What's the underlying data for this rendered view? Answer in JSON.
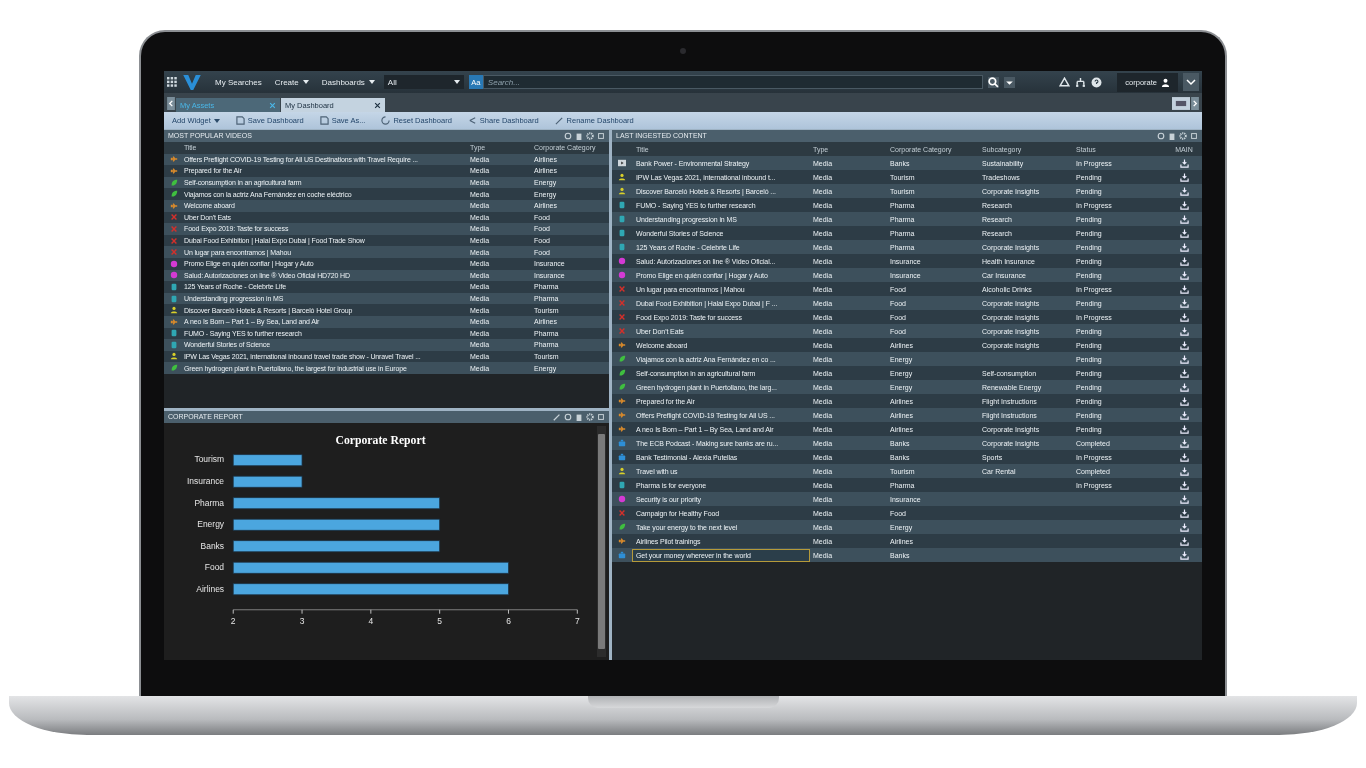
{
  "top_bar": {
    "menus": [
      {
        "label": "My Searches",
        "dropdown": false
      },
      {
        "label": "Create",
        "dropdown": true
      },
      {
        "label": "Dashboards",
        "dropdown": true
      }
    ],
    "scope": "All",
    "case_button": "Aa",
    "search": {
      "placeholder": "Search..."
    },
    "user": "corporate"
  },
  "tabs": [
    {
      "label": "My Assets",
      "selected": false
    },
    {
      "label": "My Dashboard",
      "selected": true
    }
  ],
  "toolbar": [
    {
      "label": "Add Widget",
      "kind": "menu"
    },
    {
      "label": "Save Dashboard",
      "kind": "save"
    },
    {
      "label": "Save As...",
      "kind": "save"
    },
    {
      "label": "Reset Dashboard",
      "kind": "reset"
    },
    {
      "label": "Share Dashboard",
      "kind": "share"
    },
    {
      "label": "Rename Dashboard",
      "kind": "rename"
    }
  ],
  "popular": {
    "title": "MOST POPULAR VIDEOS",
    "columns": [
      "Title",
      "Type",
      "Corporate Category"
    ],
    "rows": [
      {
        "kind": "plane",
        "title": "Offers Preflight COVID-19 Testing for All US Destinations with Travel Require ...",
        "type": "Media",
        "category": "Airlines"
      },
      {
        "kind": "plane",
        "title": "Prepared for the Air",
        "type": "Media",
        "category": "Airlines"
      },
      {
        "kind": "leaf",
        "title": "Self-consumption in an agricultural farm",
        "type": "Media",
        "category": "Energy"
      },
      {
        "kind": "leaf",
        "title": "Viajamos con la actriz Ana Fernández en coche eléctrico",
        "type": "Media",
        "category": "Energy"
      },
      {
        "kind": "plane",
        "title": "Welcome aboard",
        "type": "Media",
        "category": "Airlines"
      },
      {
        "kind": "cross",
        "title": "Uber Don't Eats",
        "type": "Media",
        "category": "Food"
      },
      {
        "kind": "cross",
        "title": "Food Expo 2019: Taste for success",
        "type": "Media",
        "category": "Food"
      },
      {
        "kind": "cross",
        "title": "Dubai Food Exhibition | Halal Expo Dubai | Food Trade Show",
        "type": "Media",
        "category": "Food"
      },
      {
        "kind": "cross",
        "title": "Un lugar para encontramos | Mahou",
        "type": "Media",
        "category": "Food"
      },
      {
        "kind": "badge",
        "title": "Promo Elige en quién confiar | Hogar y Auto",
        "type": "Media",
        "category": "Insurance"
      },
      {
        "kind": "badge",
        "title": "Salud: Autorizaciones on line ® Video Oficial HD720 HD",
        "type": "Media",
        "category": "Insurance"
      },
      {
        "kind": "bottle",
        "title": "125 Years of Roche - Celebrte Life",
        "type": "Media",
        "category": "Pharma"
      },
      {
        "kind": "bottle",
        "title": "Understanding progression in MS",
        "type": "Media",
        "category": "Pharma"
      },
      {
        "kind": "person",
        "title": "Discover Barceló Hotels & Resorts | Barceló Hotel Group",
        "type": "Media",
        "category": "Tourism"
      },
      {
        "kind": "plane",
        "title": "A neo Is Born – Part 1 – By Sea, Land and Air",
        "type": "Media",
        "category": "Airlines"
      },
      {
        "kind": "bottle",
        "title": "FUMO - Saying YES to further research",
        "type": "Media",
        "category": "Pharma"
      },
      {
        "kind": "bottle",
        "title": "Wonderful Stories of Science",
        "type": "Media",
        "category": "Pharma"
      },
      {
        "kind": "person",
        "title": "IPW Las Vegas 2021, international inbound travel trade show - Unravel Travel ...",
        "type": "Media",
        "category": "Tourism"
      },
      {
        "kind": "leaf",
        "title": "Green hydrogen plant in Puertollano, the largest for industrial use in Europe",
        "type": "Media",
        "category": "Energy"
      }
    ]
  },
  "report": {
    "title": "CORPORATE REPORT",
    "chart_data": {
      "type": "bar",
      "orientation": "horizontal",
      "title": "Corporate Report",
      "categories": [
        "Tourism",
        "Insurance",
        "Pharma",
        "Energy",
        "Banks",
        "Food",
        "Airlines"
      ],
      "values": [
        3,
        3,
        5,
        5,
        5,
        6,
        6
      ],
      "xlim": [
        2,
        7
      ],
      "xticks": [
        2,
        3,
        4,
        5,
        6,
        7
      ]
    }
  },
  "latest": {
    "title": "LAST INGESTED CONTENT",
    "columns": [
      "Title",
      "Type",
      "Corporate Category",
      "Subcategory",
      "Status",
      "MAIN"
    ],
    "rows": [
      {
        "kind": "film",
        "title": "Bank Power - Environmental Strategy",
        "type": "Media",
        "category": "Banks",
        "subcategory": "Sustainability",
        "status": "In Progress",
        "selected": false
      },
      {
        "kind": "person",
        "title": "IPW Las Vegas 2021, international inbound t...",
        "type": "Media",
        "category": "Tourism",
        "subcategory": "Tradeshows",
        "status": "Pending",
        "selected": false
      },
      {
        "kind": "person",
        "title": "Discover Barceló Hotels & Resorts | Barceló ...",
        "type": "Media",
        "category": "Tourism",
        "subcategory": "Corporate Insights",
        "status": "Pending",
        "selected": false
      },
      {
        "kind": "bottle",
        "title": "FUMO - Saying YES to further research",
        "type": "Media",
        "category": "Pharma",
        "subcategory": "Research",
        "status": "In Progress",
        "selected": false
      },
      {
        "kind": "bottle",
        "title": "Understanding progression in MS",
        "type": "Media",
        "category": "Pharma",
        "subcategory": "Research",
        "status": "Pending",
        "selected": false
      },
      {
        "kind": "bottle",
        "title": "Wonderful Stories of Science",
        "type": "Media",
        "category": "Pharma",
        "subcategory": "Research",
        "status": "Pending",
        "selected": false
      },
      {
        "kind": "bottle",
        "title": "125 Years of Roche - Celebrte Life",
        "type": "Media",
        "category": "Pharma",
        "subcategory": "Corporate Insights",
        "status": "Pending",
        "selected": false
      },
      {
        "kind": "badge",
        "title": "Salud: Autorizaciones on line ® Video Oficial...",
        "type": "Media",
        "category": "Insurance",
        "subcategory": "Health Insurance",
        "status": "Pending",
        "selected": false
      },
      {
        "kind": "badge",
        "title": "Promo Elige en quién confiar | Hogar y Auto",
        "type": "Media",
        "category": "Insurance",
        "subcategory": "Car Insurance",
        "status": "Pending",
        "selected": false
      },
      {
        "kind": "cross",
        "title": "Un lugar para encontramos | Mahou",
        "type": "Media",
        "category": "Food",
        "subcategory": "Alcoholic Drinks",
        "status": "In Progress",
        "selected": false
      },
      {
        "kind": "cross",
        "title": "Dubai Food Exhibition | Halal Expo Dubai | F ...",
        "type": "Media",
        "category": "Food",
        "subcategory": "Corporate Insights",
        "status": "Pending",
        "selected": false
      },
      {
        "kind": "cross",
        "title": "Food Expo 2019: Taste for success",
        "type": "Media",
        "category": "Food",
        "subcategory": "Corporate Insights",
        "status": "In Progress",
        "selected": false
      },
      {
        "kind": "cross",
        "title": "Uber Don't Eats",
        "type": "Media",
        "category": "Food",
        "subcategory": "Corporate Insights",
        "status": "Pending",
        "selected": false
      },
      {
        "kind": "plane",
        "title": "Welcome aboard",
        "type": "Media",
        "category": "Airlines",
        "subcategory": "Corporate Insights",
        "status": "Pending",
        "selected": false
      },
      {
        "kind": "leaf",
        "title": "Viajamos con la actriz Ana Fernández en co ...",
        "type": "Media",
        "category": "Energy",
        "status": "Pending",
        "selected": false
      },
      {
        "kind": "leaf",
        "title": "Self-consumption in an agricultural farm",
        "type": "Media",
        "category": "Energy",
        "subcategory": "Self-consumption",
        "status": "Pending",
        "selected": false
      },
      {
        "kind": "leaf",
        "title": "Green hydrogen plant in Puertollano, the larg...",
        "type": "Media",
        "category": "Energy",
        "subcategory": "Renewable Energy",
        "status": "Pending",
        "selected": false
      },
      {
        "kind": "plane",
        "title": "Prepared for the Air",
        "type": "Media",
        "category": "Airlines",
        "subcategory": "Flight Instructions",
        "status": "Pending",
        "selected": false
      },
      {
        "kind": "plane",
        "title": "Offers Preflight COVID-19 Testing for All US ...",
        "type": "Media",
        "category": "Airlines",
        "subcategory": "Flight Instructions",
        "status": "Pending",
        "selected": false
      },
      {
        "kind": "plane",
        "title": "A neo Is Born – Part 1 – By Sea, Land and Air",
        "type": "Media",
        "category": "Airlines",
        "subcategory": "Corporate Insights",
        "status": "Pending",
        "selected": false
      },
      {
        "kind": "bank",
        "title": "The ECB Podcast - Making sure banks are ru...",
        "type": "Media",
        "category": "Banks",
        "subcategory": "Corporate Insights",
        "status": "Completed",
        "selected": false
      },
      {
        "kind": "bank",
        "title": "Bank Testimonial - Alexia Putellas",
        "type": "Media",
        "category": "Banks",
        "subcategory": "Sports",
        "status": "In Progress",
        "selected": false
      },
      {
        "kind": "person",
        "title": "Travel with us",
        "type": "Media",
        "category": "Tourism",
        "subcategory": "Car Rental",
        "status": "Completed",
        "selected": false
      },
      {
        "kind": "bottle",
        "title": "Pharma is for everyone",
        "type": "Media",
        "category": "Pharma",
        "status": "In Progress",
        "selected": false
      },
      {
        "kind": "badge",
        "title": "Security is our priority",
        "type": "Media",
        "category": "Insurance",
        "selected": false
      },
      {
        "kind": "cross",
        "title": "Campaign for Healthy Food",
        "type": "Media",
        "category": "Food",
        "selected": false
      },
      {
        "kind": "leaf",
        "title": "Take your energy to the next level",
        "type": "Media",
        "category": "Energy",
        "selected": false
      },
      {
        "kind": "plane",
        "title": "Airlines Pilot trainings",
        "type": "Media",
        "category": "Airlines",
        "selected": false
      },
      {
        "kind": "bank",
        "title": "Get your money wherever in the world",
        "type": "Media",
        "category": "Banks",
        "selected": true
      }
    ]
  }
}
